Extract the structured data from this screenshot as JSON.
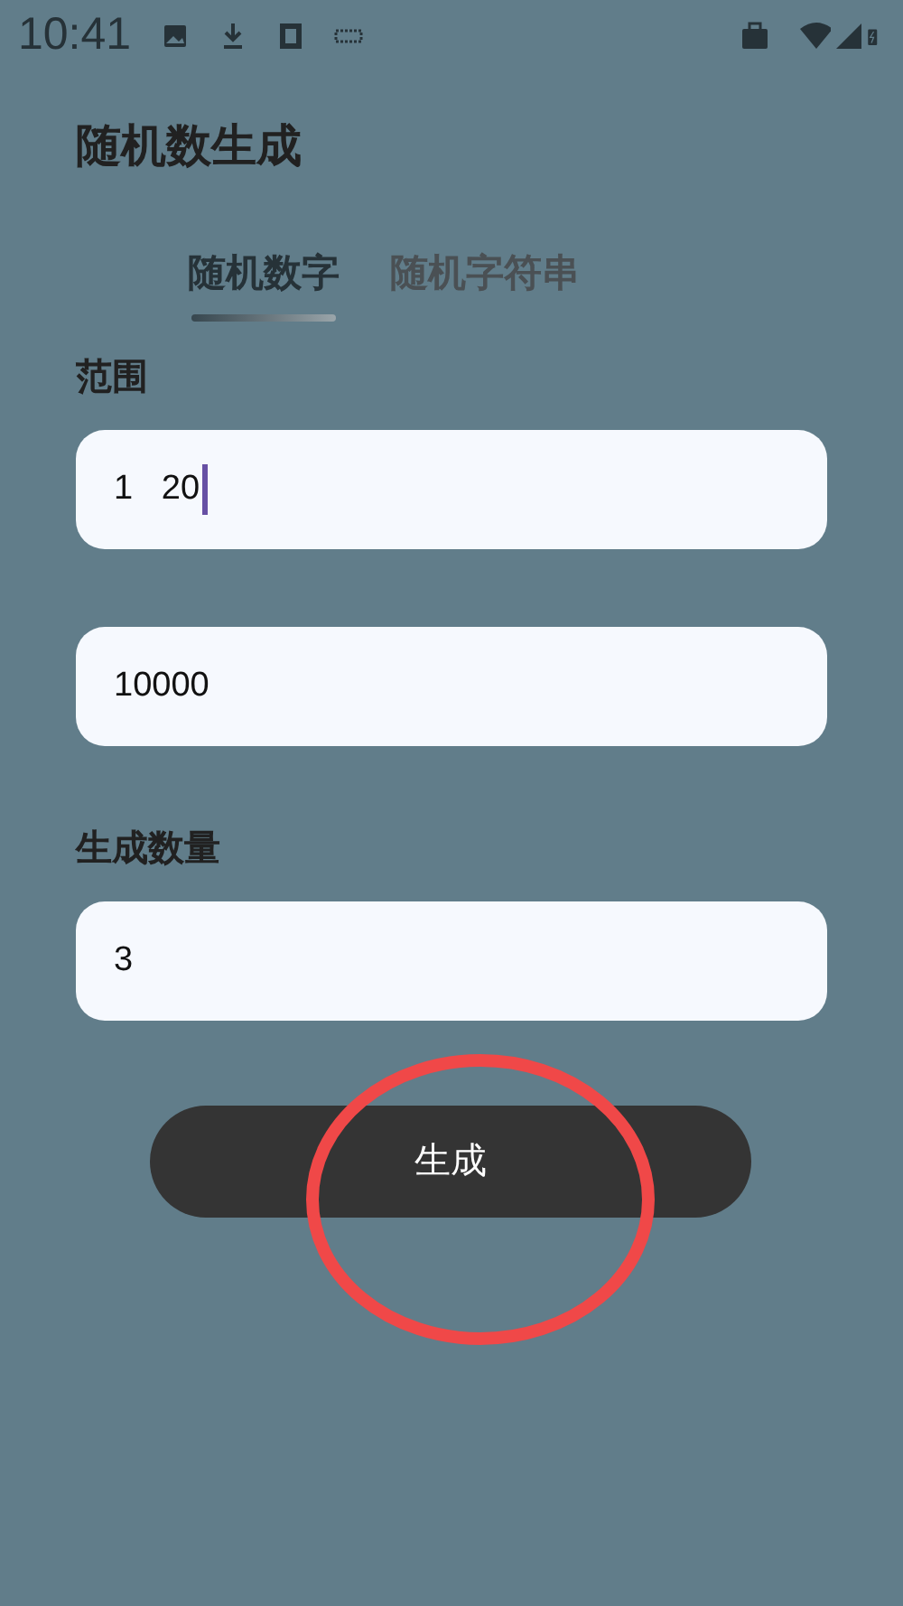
{
  "status_bar": {
    "time": "10:41"
  },
  "title": "随机数生成",
  "tabs": [
    {
      "label": "随机数字",
      "selected": true
    },
    {
      "label": "随机字符串",
      "selected": false
    }
  ],
  "sections": [
    {
      "label": "范围",
      "fields": [
        {
          "value": "1   20",
          "focused": true
        },
        {
          "value": "10000",
          "focused": false
        }
      ]
    },
    {
      "label": "生成数量",
      "fields": [
        {
          "value": "3",
          "focused": false
        }
      ]
    }
  ],
  "generate_button": "生成"
}
